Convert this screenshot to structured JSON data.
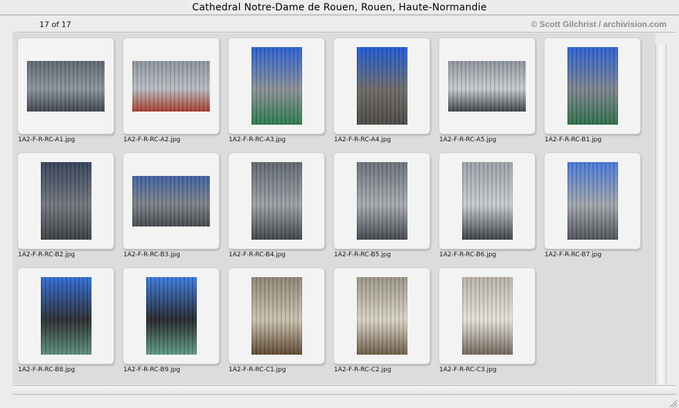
{
  "window": {
    "title": "Cathedral Notre-Dame de Rouen, Rouen, Haute-Normandie"
  },
  "status": {
    "count": "17 of 17",
    "copyright": "© Scott Gilchrist / archivision.com"
  },
  "items": [
    {
      "filename": "1A2-F-R-RC-A1.jpg",
      "orientation": "landscape",
      "palette": [
        "#5e6772",
        "#8a929c",
        "#3e444c"
      ]
    },
    {
      "filename": "1A2-F-R-RC-A2.jpg",
      "orientation": "landscape",
      "palette": [
        "#8d949c",
        "#b7bcc2",
        "#a53a2c"
      ]
    },
    {
      "filename": "1A2-F-R-RC-A3.jpg",
      "orientation": "portrait",
      "palette": [
        "#2a5fd1",
        "#8a8f96",
        "#2b7a4b"
      ]
    },
    {
      "filename": "1A2-F-R-RC-A4.jpg",
      "orientation": "portrait",
      "palette": [
        "#1d58d6",
        "#6d6a66",
        "#4b4844"
      ]
    },
    {
      "filename": "1A2-F-R-RC-A5.jpg",
      "orientation": "landscape",
      "palette": [
        "#8f959c",
        "#c6cacf",
        "#3d4247"
      ]
    },
    {
      "filename": "1A2-F-R-RC-B1.jpg",
      "orientation": "portrait",
      "palette": [
        "#2b60d4",
        "#7d838b",
        "#2e6e4a"
      ]
    },
    {
      "filename": "1A2-F-R-RC-B2.jpg",
      "orientation": "portrait",
      "palette": [
        "#35415a",
        "#70757c",
        "#3a3d42"
      ]
    },
    {
      "filename": "1A2-F-R-RC-B3.jpg",
      "orientation": "landscape",
      "palette": [
        "#3f5fa0",
        "#7c8188",
        "#45494f"
      ]
    },
    {
      "filename": "1A2-F-R-RC-B4.jpg",
      "orientation": "portrait",
      "palette": [
        "#5f666e",
        "#9aa0a6",
        "#3c4248"
      ]
    },
    {
      "filename": "1A2-F-R-RC-B5.jpg",
      "orientation": "portrait",
      "palette": [
        "#6a7078",
        "#a4a9ae",
        "#41464c"
      ]
    },
    {
      "filename": "1A2-F-R-RC-B6.jpg",
      "orientation": "portrait",
      "palette": [
        "#9aa1a8",
        "#c7cbcf",
        "#3a3f44"
      ]
    },
    {
      "filename": "1A2-F-R-RC-B7.jpg",
      "orientation": "portrait",
      "palette": [
        "#4877d8",
        "#a0a5ab",
        "#4c5156"
      ]
    },
    {
      "filename": "1A2-F-R-RC-B8.jpg",
      "orientation": "portrait",
      "palette": [
        "#2f6ad6",
        "#2a2c2f",
        "#5a8f79"
      ]
    },
    {
      "filename": "1A2-F-R-RC-B9.jpg",
      "orientation": "portrait",
      "palette": [
        "#3a78de",
        "#24262a",
        "#5f9a85"
      ]
    },
    {
      "filename": "1A2-F-R-RC-C1.jpg",
      "orientation": "portrait",
      "palette": [
        "#8f8473",
        "#c9c0ad",
        "#5c4630"
      ]
    },
    {
      "filename": "1A2-F-R-RC-C2.jpg",
      "orientation": "portrait",
      "palette": [
        "#9a9486",
        "#d8d2c4",
        "#6b5b47"
      ]
    },
    {
      "filename": "1A2-F-R-RC-C3.jpg",
      "orientation": "portrait",
      "palette": [
        "#b8b2a8",
        "#e4e0d8",
        "#6e6458"
      ]
    }
  ]
}
